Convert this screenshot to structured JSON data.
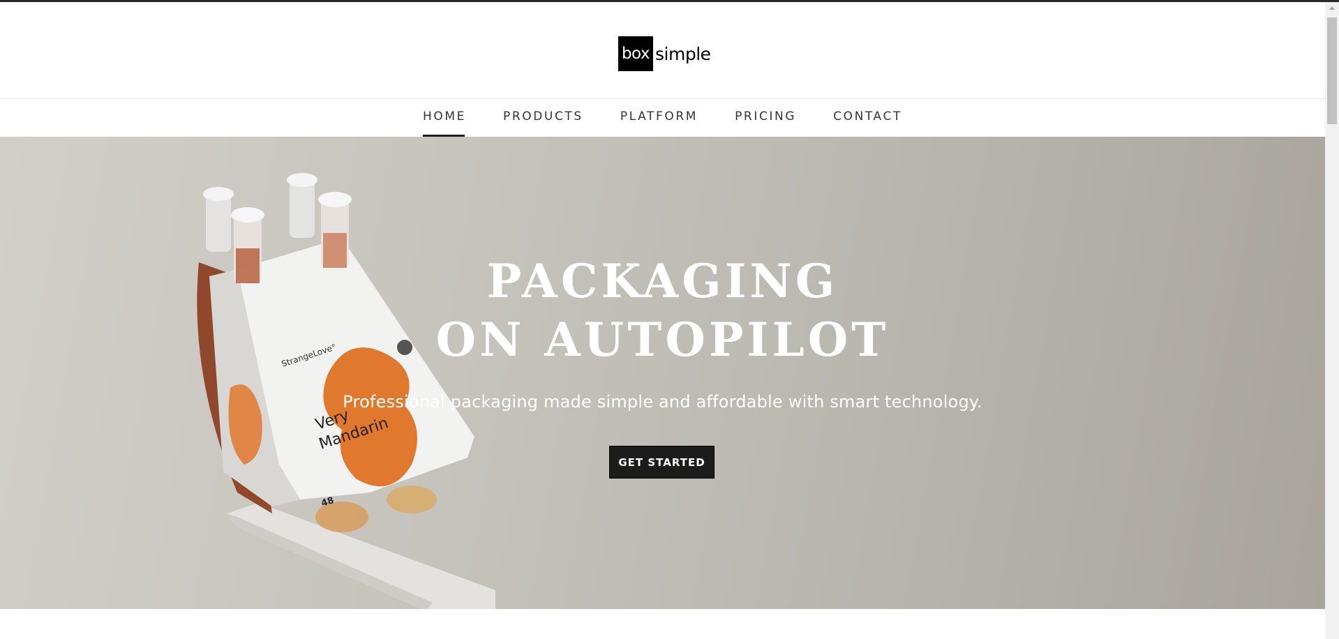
{
  "logo": {
    "box_text": "box",
    "word_text": "simple"
  },
  "nav": {
    "items": [
      {
        "label": "HOME",
        "active": true
      },
      {
        "label": "PRODUCTS"
      },
      {
        "label": "PLATFORM"
      },
      {
        "label": "PRICING"
      },
      {
        "label": "CONTACT"
      }
    ]
  },
  "hero": {
    "title_line1": "PACKAGING",
    "title_line2": "ON AUTOPILOT",
    "subtitle": "Professional packaging made simple and affordable with smart technology.",
    "cta_label": "GET STARTED",
    "image": {
      "brand": "StrangeLove°",
      "product_line1": "Very",
      "product_line2": "Mandarin",
      "count": "48"
    }
  },
  "colors": {
    "hero_text": "#ffffff",
    "cta_bg": "#1c1c1c",
    "accent_orange": "#e0782e",
    "nav_text": "#333333"
  }
}
